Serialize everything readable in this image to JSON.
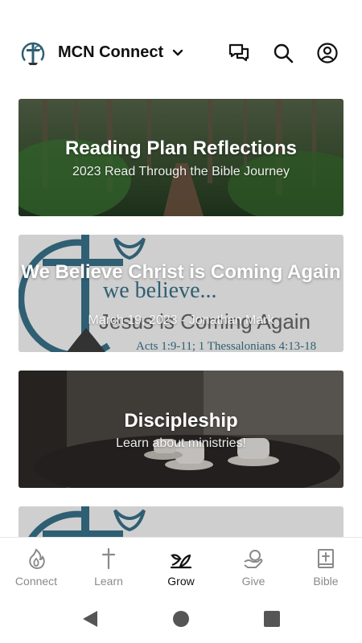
{
  "header": {
    "title": "MCN Connect",
    "icons": [
      "logo-icon",
      "chevron-down-icon",
      "chat-icon",
      "search-icon",
      "account-icon"
    ]
  },
  "cards": [
    {
      "title": "Reading Plan Reflections",
      "subtitle": "2023 Read Through the Bible Journey"
    },
    {
      "title": "We Believe Christ is Coming Again",
      "subtitle": "March 19, 2023 - Jonathan Mark",
      "image_text": {
        "line1": "we believe...",
        "line2": "Jesus is Coming Again",
        "line3": "Acts 1:9-11; 1 Thessalonians 4:13-18"
      }
    },
    {
      "title": "Discipleship",
      "subtitle": "Learn about ministries!"
    }
  ],
  "bottom_nav": [
    {
      "label": "Connect",
      "icon": "flame-icon"
    },
    {
      "label": "Learn",
      "icon": "cross-icon"
    },
    {
      "label": "Grow",
      "icon": "sprout-icon",
      "active": true
    },
    {
      "label": "Give",
      "icon": "give-icon"
    },
    {
      "label": "Bible",
      "icon": "bible-icon"
    }
  ],
  "colors": {
    "accent_teal": "#2f5f73",
    "text_dark": "#111111",
    "nav_inactive": "#8a8a8a"
  }
}
